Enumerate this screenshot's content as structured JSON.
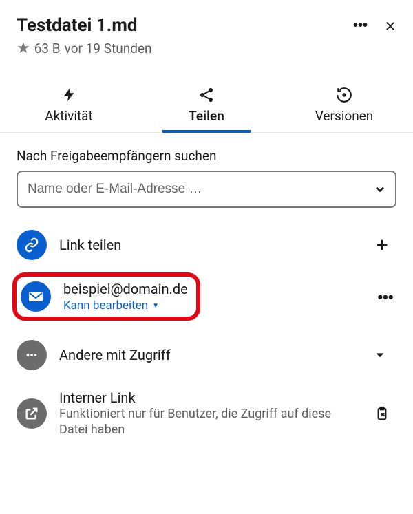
{
  "header": {
    "title": "Testdatei 1.md",
    "size": "63 B",
    "timeago": "vor 19 Stunden"
  },
  "tabs": {
    "activity": "Aktivität",
    "share": "Teilen",
    "versions": "Versionen"
  },
  "share": {
    "searchLabel": "Nach Freigabeempfängern suchen",
    "placeholder": "Name oder E-Mail-Adresse …"
  },
  "rows": {
    "linkShare": "Link teilen",
    "user": {
      "email": "beispiel@domain.de",
      "permission": "Kann bearbeiten"
    },
    "others": "Andere mit Zugriff",
    "internal": {
      "title": "Interner Link",
      "desc": "Funktioniert nur für Benutzer, die Zugriff auf diese Datei haben"
    }
  }
}
